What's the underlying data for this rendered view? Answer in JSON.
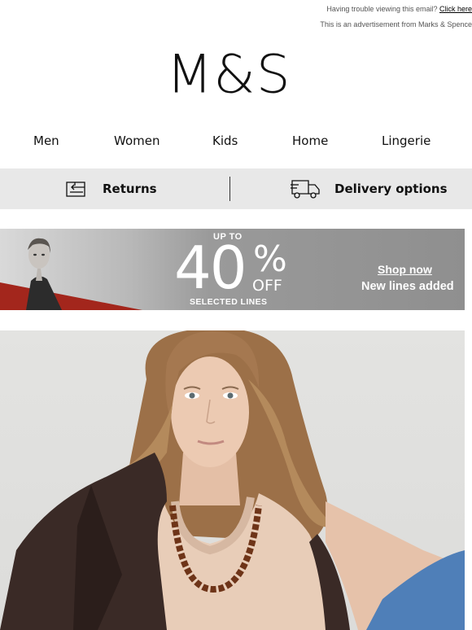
{
  "preheader": {
    "trouble_text": "Having trouble viewing this email? ",
    "click_here": "Click here",
    "advert_text": "This is an advertisement from Marks & Spence"
  },
  "logo": {
    "text": "M&S"
  },
  "nav": {
    "items": [
      "Men",
      "Women",
      "Kids",
      "Home",
      "Lingerie"
    ]
  },
  "services": {
    "returns_label": "Returns",
    "delivery_label": "Delivery options",
    "returns_icon": "returns-box-icon",
    "delivery_icon": "delivery-truck-icon",
    "bar_color": "#e8e8e8"
  },
  "promo": {
    "up_to": "UP TO",
    "percent_number": "40",
    "percent_sign": "%",
    "off": "OFF",
    "selected_lines": "SELECTED LINES",
    "shop_now": "Shop now",
    "new_lines": "New lines added",
    "accent_color": "#a3261c"
  },
  "hero": {
    "image_name": "model-hero-image"
  }
}
